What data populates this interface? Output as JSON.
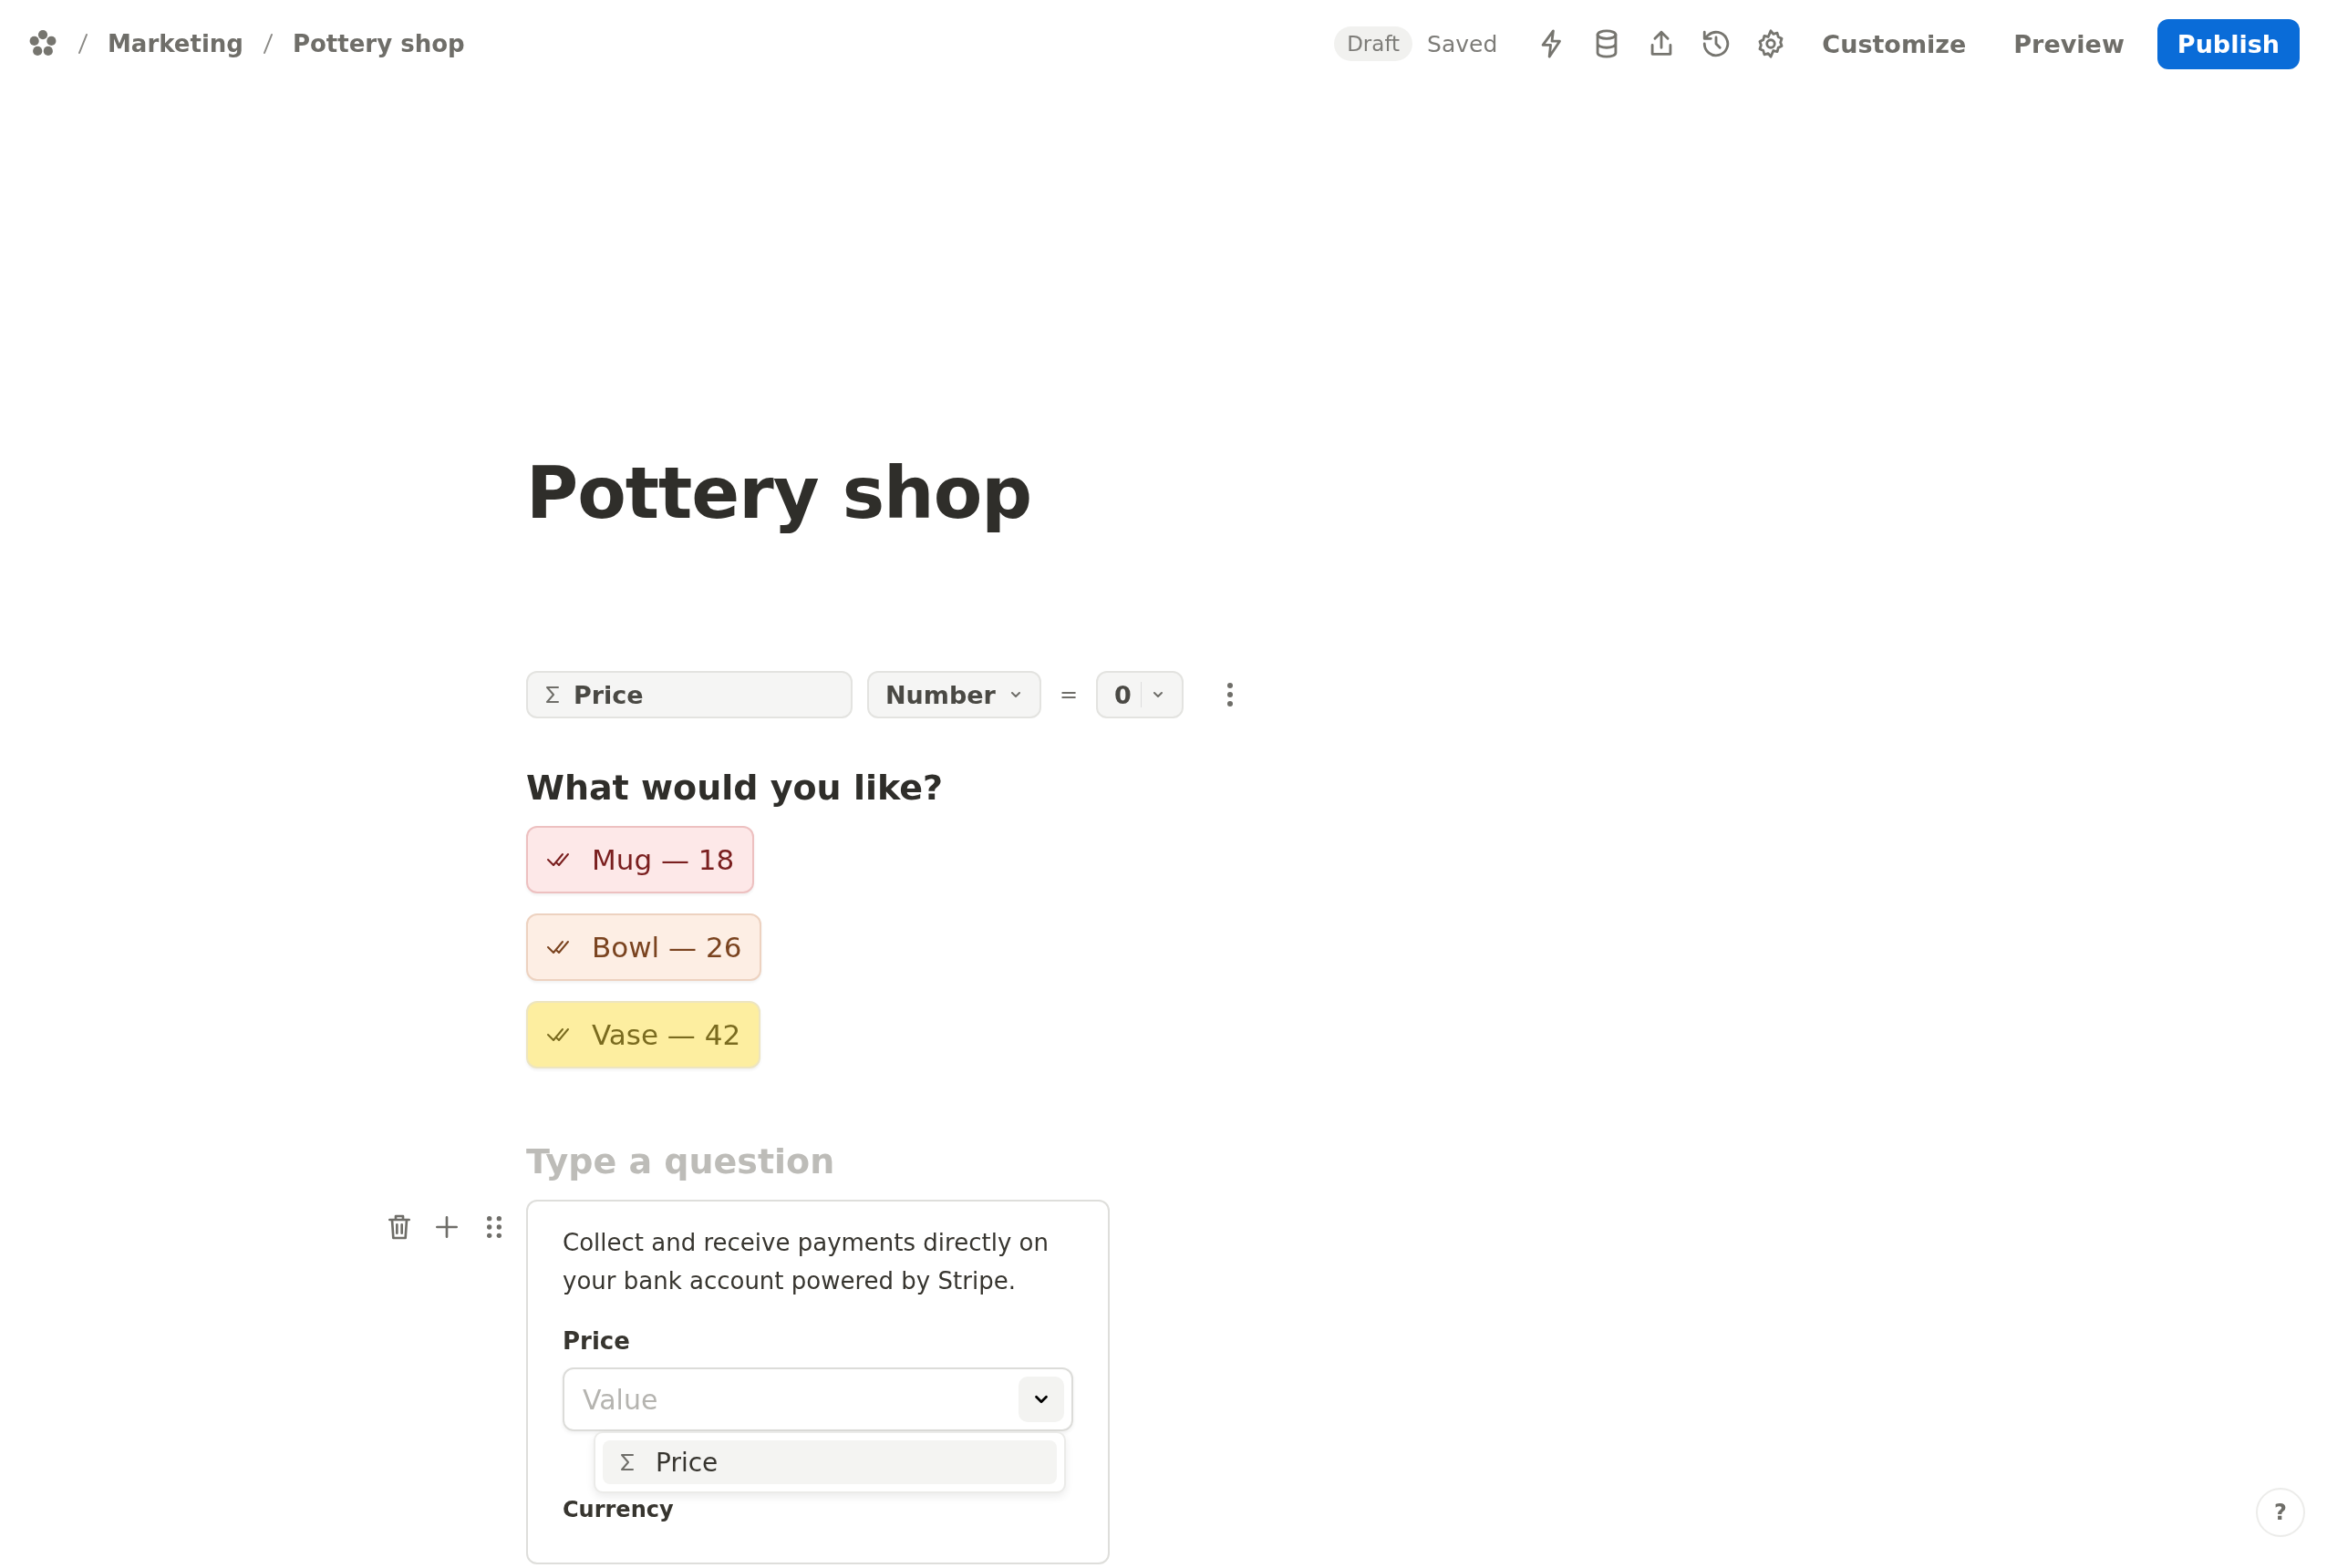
{
  "breadcrumb": {
    "items": [
      "Marketing",
      "Pottery shop"
    ]
  },
  "header": {
    "status": "Draft",
    "save_state": "Saved",
    "actions": [
      "Customize",
      "Preview"
    ],
    "primary": "Publish"
  },
  "title": "Pottery shop",
  "logic": {
    "variable": "Price",
    "type": "Number",
    "operator": "=",
    "value": "0"
  },
  "question": {
    "title": "What would you like?",
    "choices": [
      {
        "label": "Mug — 18",
        "color": "#fde8e8"
      },
      {
        "label": "Bowl — 26",
        "color": "#fdeee4"
      },
      {
        "label": "Vase — 42",
        "color": "#fdeea0"
      }
    ]
  },
  "new_question": {
    "placeholder": "Type a question"
  },
  "payment_block": {
    "description": "Collect and receive payments directly on your bank account powered by Stripe.",
    "price_label": "Price",
    "price_select": {
      "placeholder": "Value",
      "expanded": true
    },
    "menu": [
      {
        "label": "Price"
      }
    ],
    "currency_label": "Currency"
  },
  "help": "?"
}
